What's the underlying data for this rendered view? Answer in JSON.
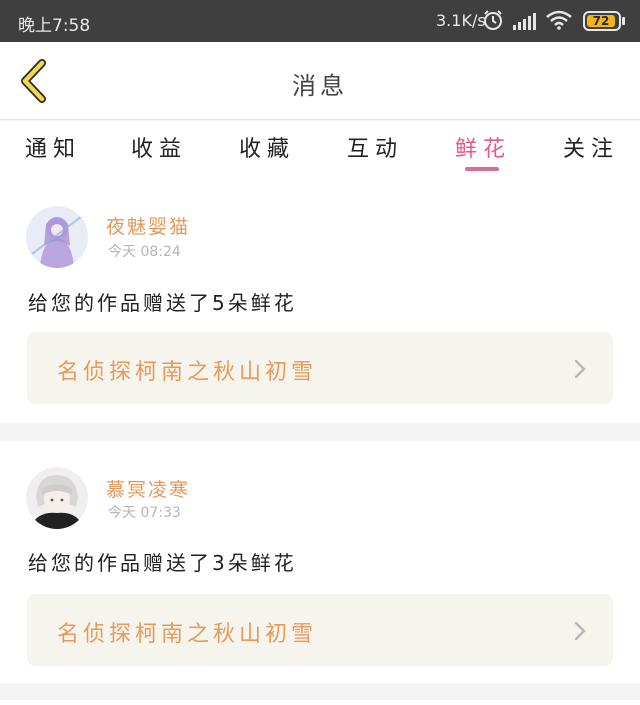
{
  "status_bar": {
    "time": "晚上7:58",
    "net_speed": "3.1K/s",
    "battery": "72",
    "icons": [
      "alarm-icon",
      "signal-icon",
      "wifi-icon",
      "battery-icon"
    ]
  },
  "header": {
    "title": "消息",
    "back_icon": "chevron-left-icon"
  },
  "tabs": [
    {
      "label": "通知"
    },
    {
      "label": "收益"
    },
    {
      "label": "收藏"
    },
    {
      "label": "互动"
    },
    {
      "label": "鲜花",
      "active": true
    },
    {
      "label": "关注"
    }
  ],
  "messages": [
    {
      "username": "夜魅婴猫",
      "time": "今天 08:24",
      "text": "给您的作品赠送了5朵鲜花",
      "work_title": "名侦探柯南之秋山初雪"
    },
    {
      "username": "慕冥凌寒",
      "time": "今天 07:33",
      "text": "给您的作品赠送了3朵鲜花",
      "work_title": "名侦探柯南之秋山初雪"
    }
  ],
  "colors": {
    "accent_tab": "#e05a8e",
    "username": "#e3995a",
    "work_title": "#e79a5e",
    "back_icon": "#f2d84c",
    "status_bar_bg": "#3f3f3f"
  }
}
